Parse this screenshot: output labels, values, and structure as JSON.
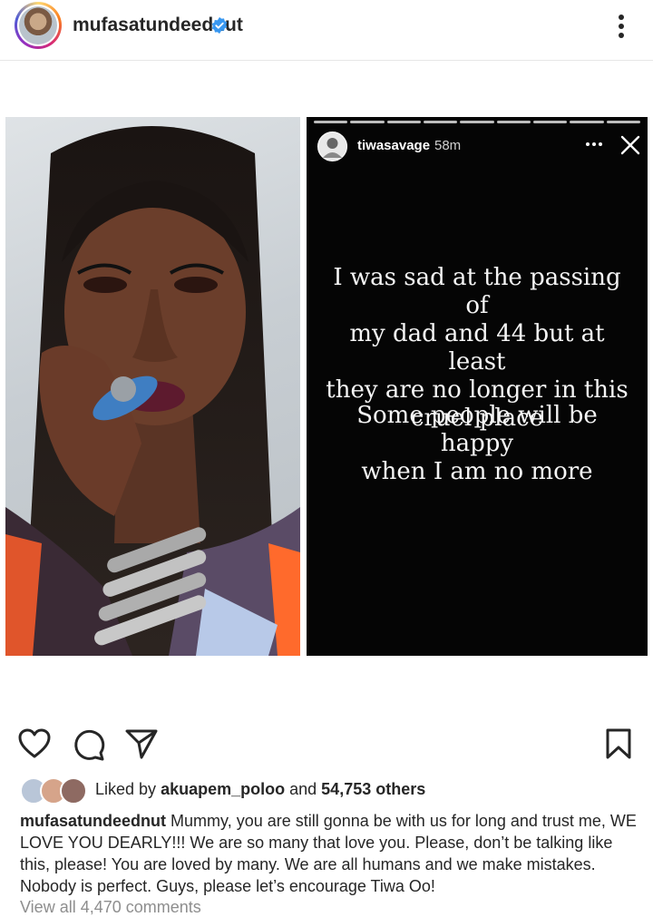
{
  "header": {
    "username": "mufasatundeednut",
    "verified_icon": "verified-badge-icon",
    "more_icon": "more-vertical-icon"
  },
  "story": {
    "username": "tiwasavage",
    "time": "58m",
    "lines_1": [
      "I was sad at the passing of",
      "my dad and 44 but at least",
      "they are no longer in this",
      "cruel place"
    ],
    "lines_2": [
      "Some people will be happy",
      "when I am no more"
    ]
  },
  "actions": {
    "like_icon": "heart-icon",
    "comment_icon": "comment-icon",
    "share_icon": "send-icon",
    "save_icon": "bookmark-icon"
  },
  "likes": {
    "prefix": "Liked by",
    "user": "akuapem_poloo",
    "middle": "and",
    "count": "54,753 others"
  },
  "caption": {
    "username": "mufasatundeednut",
    "text": "Mummy, you are still gonna be with us for long and trust me, WE LOVE YOU DEARLY!!! We are so many that love you. Please, don’t be talking like this, please! You are loved by many. We are all humans and we make mistakes. Nobody is perfect. Guys, please let’s encourage Tiwa Oo!"
  },
  "comments": {
    "view_all": "View all 4,470 comments"
  },
  "colors": {
    "verified": "#3897f0",
    "text": "#262626",
    "muted": "#8e8e8e"
  }
}
